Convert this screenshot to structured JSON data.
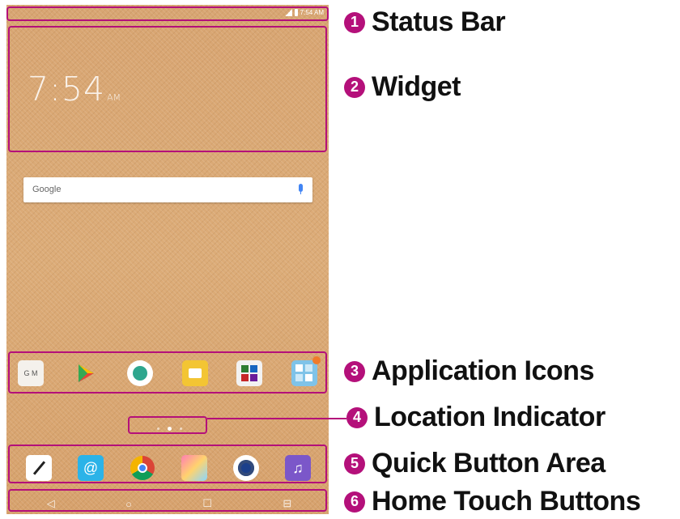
{
  "status_bar": {
    "time": "7:54 AM"
  },
  "widget": {
    "time": "7:54",
    "ampm": "AM"
  },
  "search": {
    "logo": "Google"
  },
  "app_icons": [
    {
      "name": "google-apps-folder-icon",
      "text": "G M"
    },
    {
      "name": "play-store-icon",
      "text": ""
    },
    {
      "name": "contacts-icon",
      "text": ""
    },
    {
      "name": "messaging-icon",
      "text": ""
    },
    {
      "name": "office-folder-icon",
      "text": ""
    },
    {
      "name": "folder-icon",
      "text": ""
    }
  ],
  "quick_icons": [
    {
      "name": "notes-icon"
    },
    {
      "name": "email-icon",
      "text": "@"
    },
    {
      "name": "chrome-icon"
    },
    {
      "name": "gallery-icon"
    },
    {
      "name": "camera-icon"
    },
    {
      "name": "music-icon",
      "text": "♫"
    }
  ],
  "nav": {
    "back": "◁",
    "home": "○",
    "recent": "☐",
    "extra": "⊟"
  },
  "callouts": [
    {
      "number": "1",
      "text": "Status Bar"
    },
    {
      "number": "2",
      "text": "Widget"
    },
    {
      "number": "3",
      "text": "Application Icons"
    },
    {
      "number": "4",
      "text": "Location Indicator"
    },
    {
      "number": "5",
      "text": "Quick Button Area"
    },
    {
      "number": "6",
      "text": "Home Touch Buttons"
    }
  ],
  "colors": {
    "accent": "#b4107a",
    "wallpaper": "#d9a772"
  }
}
